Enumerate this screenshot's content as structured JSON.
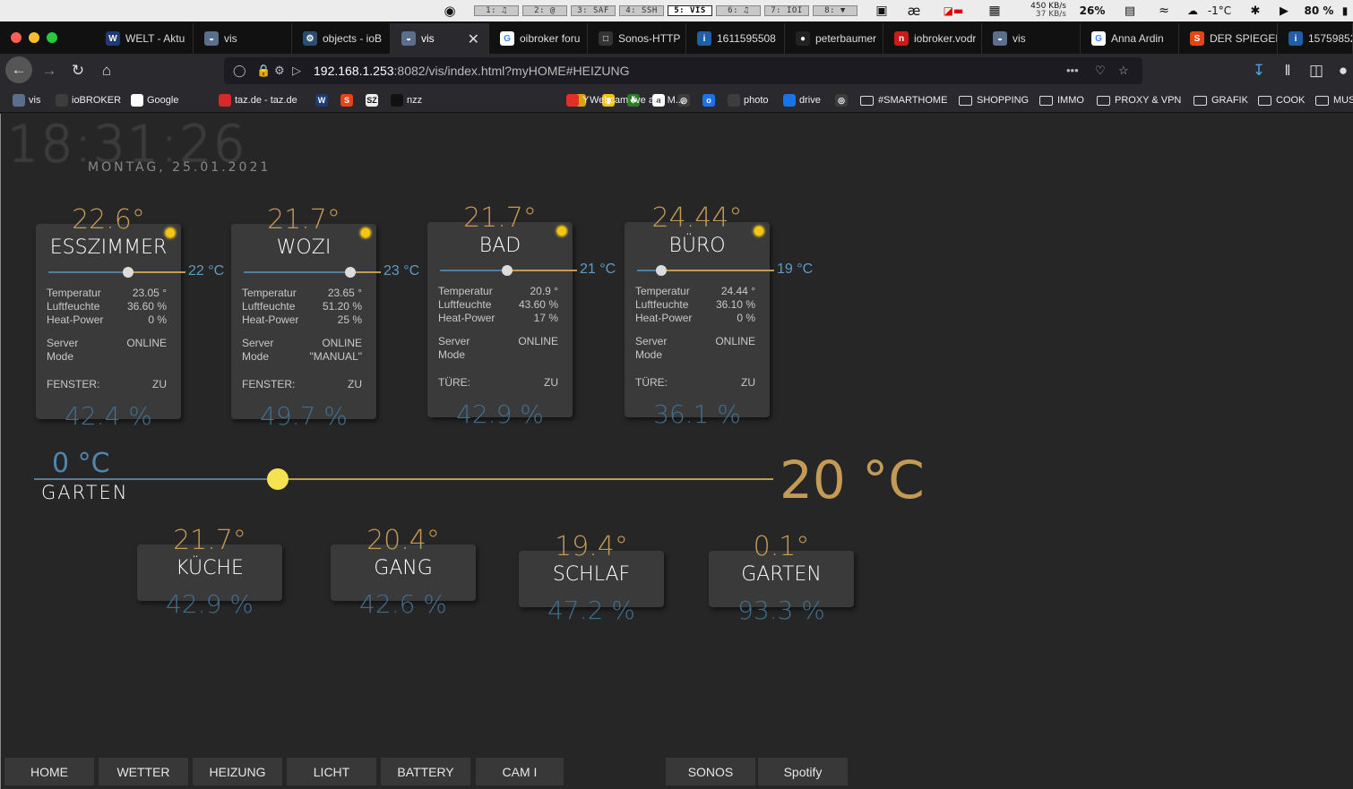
{
  "menubar": {
    "workspaces": [
      "1: ♫",
      "2: @",
      "3: SAF",
      "4: SSH",
      "5: VIS",
      "6: ♫",
      "7: IOI",
      "8: ▼"
    ],
    "net_down": "450 KB/s",
    "net_up": "37 KB/s",
    "cpu": "26%",
    "weather": "-1°C",
    "battery": "80 %"
  },
  "tabs": [
    {
      "label": "WELT - Aktu",
      "icon_text": "W",
      "icon_color": "#1f3b73"
    },
    {
      "label": "vis",
      "icon_text": "◒",
      "icon_color": "#5b6e8c"
    },
    {
      "label": "objects - ioB",
      "icon_text": "⚙",
      "icon_color": "#2b4d6f"
    },
    {
      "label": "vis",
      "icon_text": "◒",
      "icon_color": "#5b6e8c"
    },
    {
      "label": "oibroker foru",
      "icon_text": "G",
      "icon_color": "#ffffff"
    },
    {
      "label": "Sonos-HTTP",
      "icon_text": "□",
      "icon_color": "#333333"
    },
    {
      "label": "1611595508",
      "icon_text": "i",
      "icon_color": "#1e5fa8"
    },
    {
      "label": "peterbaumer",
      "icon_text": "●",
      "icon_color": "#222222"
    },
    {
      "label": "iobroker.vodr",
      "icon_text": "n",
      "icon_color": "#cc1a1a"
    },
    {
      "label": "vis",
      "icon_text": "◒",
      "icon_color": "#5b6e8c"
    },
    {
      "label": "Anna Ardin",
      "icon_text": "G",
      "icon_color": "#ffffff"
    },
    {
      "label": "DER SPIEGEL",
      "icon_text": "S",
      "icon_color": "#e64415"
    },
    {
      "label": "15759852",
      "icon_text": "i",
      "icon_color": "#1e5fa8"
    }
  ],
  "url": {
    "host": "192.168.1.253",
    "rest": ":8082/vis/index.html?myHOME#HEIZUNG"
  },
  "bookmarks": [
    {
      "label": "vis",
      "type": "site"
    },
    {
      "label": "ioBROKER",
      "type": "site"
    },
    {
      "label": "Google",
      "type": "site"
    },
    {
      "label": "taz.de - taz.de",
      "type": "site"
    },
    {
      "label": "nzz",
      "type": "site"
    },
    {
      "label": "Webcam live aus M...",
      "type": "site"
    },
    {
      "label": "Y",
      "type": "site"
    },
    {
      "label": "photo",
      "type": "site"
    },
    {
      "label": "drive",
      "type": "site"
    },
    {
      "label": "#SMARTHOME",
      "type": "folder"
    },
    {
      "label": "SHOPPING",
      "type": "folder"
    },
    {
      "label": "IMMO",
      "type": "folder"
    },
    {
      "label": "PROXY & VPN",
      "type": "folder"
    },
    {
      "label": "GRAFIK",
      "type": "folder"
    },
    {
      "label": "COOK",
      "type": "folder"
    },
    {
      "label": "MUS",
      "type": "folder"
    }
  ],
  "clock": {
    "time": "18:31:26",
    "date": "MONTAG, 25.01.2021"
  },
  "rooms": [
    {
      "name": "ESSZIMMER",
      "temp": "22.6°",
      "setpoint": "22 °C",
      "setpoint_level": 0.6,
      "temperatur_label": "Temperatur",
      "temperatur": "23.05 °",
      "luft_label": "Luftfeuchte",
      "luft": "36.60 %",
      "heat_label": "Heat-Power",
      "heat": "0 %",
      "server_label": "Server",
      "server": "ONLINE",
      "mode_label": "Mode",
      "mode": "",
      "sensor_label": "FENSTER:",
      "sensor": "ZU",
      "humidity": "42.4 %"
    },
    {
      "name": "WOZI",
      "temp": "21.7°",
      "setpoint": "23 °C",
      "setpoint_level": 0.8,
      "temperatur_label": "Temperatur",
      "temperatur": "23.65 °",
      "luft_label": "Luftfeuchte",
      "luft": "51.20 %",
      "heat_label": "Heat-Power",
      "heat": "25 %",
      "server_label": "Server",
      "server": "ONLINE",
      "mode_label": "Mode",
      "mode": "\"MANUAL\"",
      "sensor_label": "FENSTER:",
      "sensor": "ZU",
      "humidity": "49.7 %"
    },
    {
      "name": "BAD",
      "temp": "21.7°",
      "setpoint": "21 °C",
      "setpoint_level": 0.5,
      "temperatur_label": "Temperatur",
      "temperatur": "20.9 °",
      "luft_label": "Luftfeuchte",
      "luft": "43.60 %",
      "heat_label": "Heat-Power",
      "heat": "17 %",
      "server_label": "Server",
      "server": "ONLINE",
      "mode_label": "Mode",
      "mode": "",
      "sensor_label": "TÜRE:",
      "sensor": "ZU",
      "humidity": "42.9 %"
    },
    {
      "name": "BÜRO",
      "temp": "24.44°",
      "setpoint": "19 °C",
      "setpoint_level": 0.18,
      "temperatur_label": "Temperatur",
      "temperatur": "24.44 °",
      "luft_label": "Luftfeuchte",
      "luft": "36.10 %",
      "heat_label": "Heat-Power",
      "heat": "0 %",
      "server_label": "Server",
      "server": "ONLINE",
      "mode_label": "Mode",
      "mode": "",
      "sensor_label": "TÜRE:",
      "sensor": "ZU",
      "humidity": "36.1 %"
    }
  ],
  "garden": {
    "current": "0 °C",
    "name": "GARTEN",
    "setpoint": "20 °C",
    "level": 0.33
  },
  "mini_rooms": [
    {
      "name": "KÜCHE",
      "temp": "21.7°",
      "humidity": "42.9 %"
    },
    {
      "name": "GANG",
      "temp": "20.4°",
      "humidity": "42.6 %"
    },
    {
      "name": "SCHLAF",
      "temp": "19.4°",
      "humidity": "47.2 %"
    },
    {
      "name": "GARTEN",
      "temp": "0.1°",
      "humidity": "93.3 %"
    }
  ],
  "nav_buttons": [
    "HOME",
    "WETTER",
    "HEIZUNG",
    "LICHT",
    "BATTERY",
    "CAM I",
    "SONOS",
    "Spotify"
  ],
  "colors": {
    "warm": "#c39a56",
    "cool": "#4f7ea0",
    "humidity": "#3f6f8f",
    "led": "#f5c518"
  }
}
